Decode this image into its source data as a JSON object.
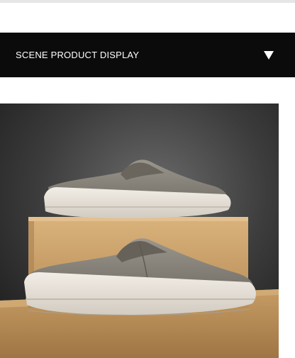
{
  "banner": {
    "title": "SCENE PRODUCT DISPLAY",
    "icon": "triangle-down-icon"
  },
  "scene": {
    "background_color": "#3a3a3a",
    "box_color": "#c9a06a",
    "shoe_color": "#8e8a80",
    "sole_color": "#e8e2da"
  }
}
